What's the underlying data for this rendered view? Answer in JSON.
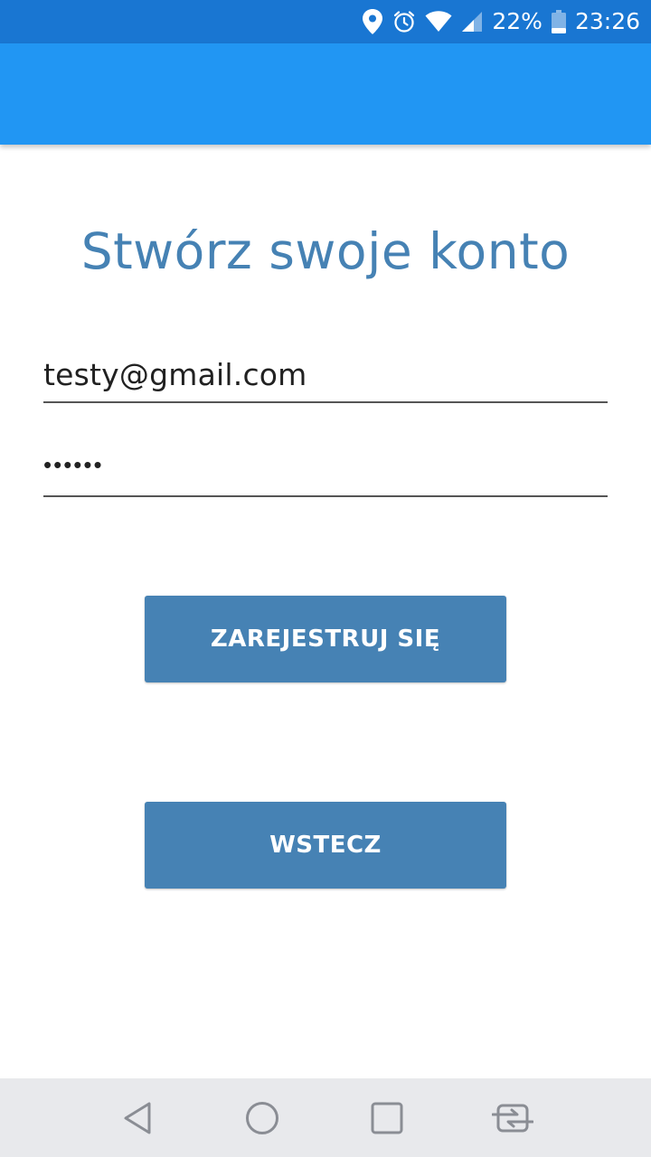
{
  "status_bar": {
    "battery": "22%",
    "time": "23:26",
    "icons": [
      "location-icon",
      "alarm-icon",
      "wifi-icon",
      "signal-icon",
      "battery-icon"
    ]
  },
  "main": {
    "title": "Stwórz swoje konto",
    "email_value": "testy@gmail.com",
    "password_masked": "••••••",
    "register_button": "ZAREJESTRUJ SIĘ",
    "back_button": "WSTECZ"
  },
  "nav_bar": {
    "icons": [
      "back-triangle-icon",
      "home-circle-icon",
      "recents-square-icon",
      "switch-apps-icon"
    ]
  },
  "colors": {
    "status_bar": "#1976D2",
    "app_bar": "#2196F3",
    "accent": "#4682B4",
    "nav_bar": "#E8E9EC"
  }
}
